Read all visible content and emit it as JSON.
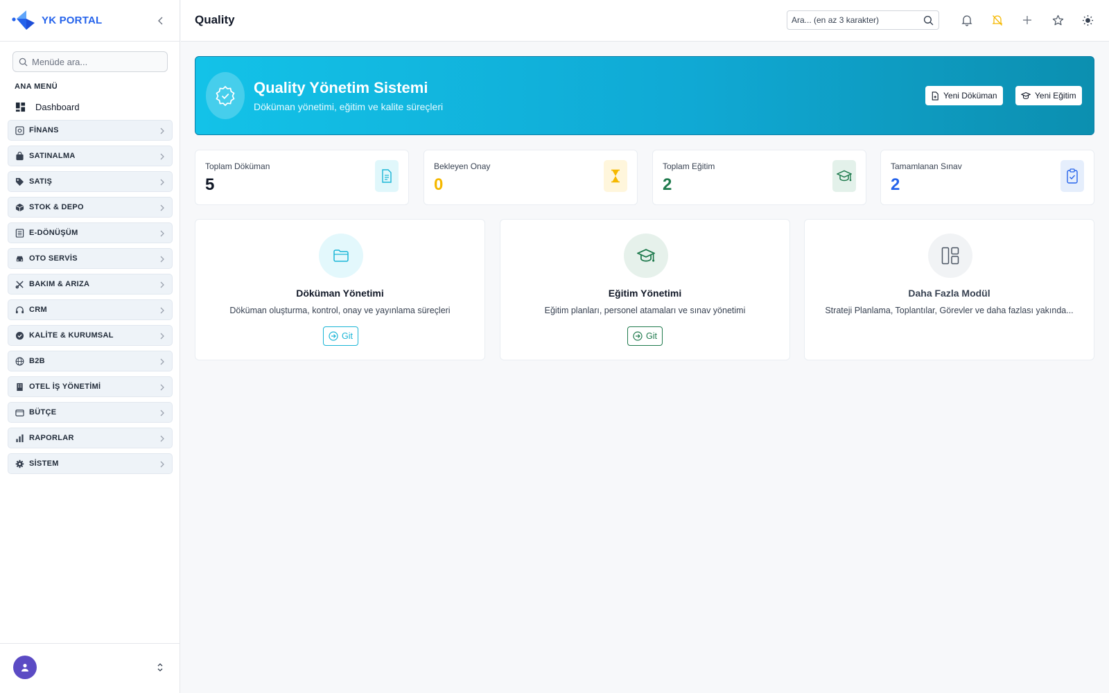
{
  "brand": {
    "name": "YK PORTAL"
  },
  "sidebar": {
    "search_placeholder": "Menüde ara...",
    "section_title": "ANA MENÜ",
    "dashboard_label": "Dashboard",
    "items": [
      {
        "label": "FİNANS",
        "icon": "finance-icon"
      },
      {
        "label": "SATINALMA",
        "icon": "shopping-bag-icon"
      },
      {
        "label": "SATIŞ",
        "icon": "tag-icon"
      },
      {
        "label": "STOK & DEPO",
        "icon": "box-icon"
      },
      {
        "label": "E-DÖNÜŞÜM",
        "icon": "document-list-icon"
      },
      {
        "label": "OTO SERVİS",
        "icon": "car-icon"
      },
      {
        "label": "BAKIM & ARIZA",
        "icon": "tools-icon"
      },
      {
        "label": "CRM",
        "icon": "headset-icon"
      },
      {
        "label": "KALİTE & KURUMSAL",
        "icon": "badge-check-icon"
      },
      {
        "label": "B2B",
        "icon": "globe-icon"
      },
      {
        "label": "OTEL İŞ YÖNETİMİ",
        "icon": "building-icon"
      },
      {
        "label": "BÜTÇE",
        "icon": "wallet-icon"
      },
      {
        "label": "RAPORLAR",
        "icon": "bar-chart-icon"
      },
      {
        "label": "SİSTEM",
        "icon": "gear-icon"
      }
    ]
  },
  "header": {
    "title": "Quality",
    "search_placeholder": "Ara... (en az 3 karakter)"
  },
  "hero": {
    "title": "Quality Yönetim Sistemi",
    "subtitle": "Döküman yönetimi, eğitim ve kalite süreçleri",
    "new_document_label": "Yeni Döküman",
    "new_training_label": "Yeni Eğitim"
  },
  "stats": [
    {
      "label": "Toplam Döküman",
      "value": "5",
      "color": "#111827",
      "icon": "document-icon",
      "icon_bg": "#e0f7fb",
      "icon_color": "#19b5d6"
    },
    {
      "label": "Bekleyen Onay",
      "value": "0",
      "color": "#f5b800",
      "icon": "hourglass-icon",
      "icon_bg": "#fff6dc",
      "icon_color": "#f5b800"
    },
    {
      "label": "Toplam Eğitim",
      "value": "2",
      "color": "#1f7a4d",
      "icon": "graduation-cap-icon",
      "icon_bg": "#e3f1ea",
      "icon_color": "#1f7a4d"
    },
    {
      "label": "Tamamlanan Sınav",
      "value": "2",
      "color": "#2563eb",
      "icon": "clipboard-check-icon",
      "icon_bg": "#e5eefc",
      "icon_color": "#2563eb"
    }
  ],
  "modules": [
    {
      "title": "Döküman Yönetimi",
      "desc": "Döküman oluşturma, kontrol, onay ve yayınlama süreçleri",
      "button": "Git",
      "icon": "folder-icon",
      "color": "#19b5d6",
      "icon_bg": "#e3f8fc"
    },
    {
      "title": "Eğitim Yönetimi",
      "desc": "Eğitim planları, personel atamaları ve sınav yönetimi",
      "button": "Git",
      "icon": "graduation-cap-icon",
      "color": "#1f7a4d",
      "icon_bg": "#e6f1eb"
    },
    {
      "title": "Daha Fazla Modül",
      "desc": "Strateji Planlama, Toplantılar, Görevler ve daha fazlası yakında...",
      "button": "",
      "icon": "layout-icon",
      "color": "#4b5563",
      "icon_bg": "#f1f3f5"
    }
  ]
}
